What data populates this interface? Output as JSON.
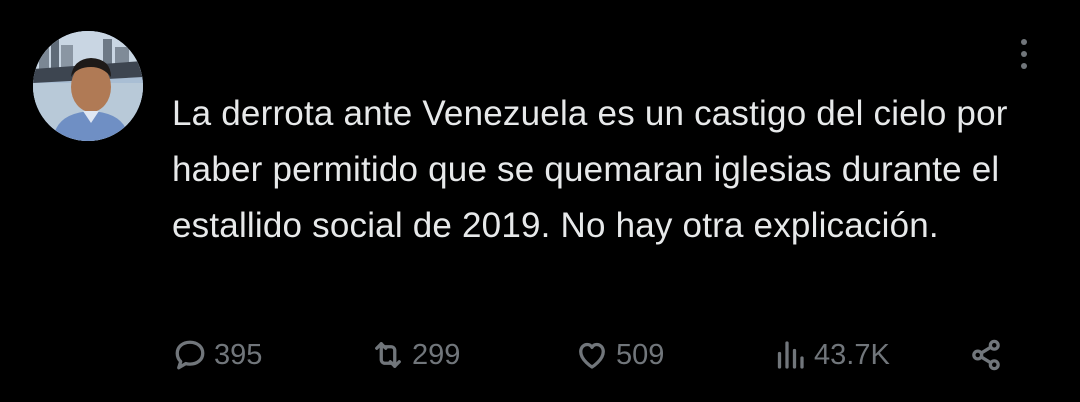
{
  "author": {
    "name": "",
    "handle": "",
    "time": ""
  },
  "tweet": {
    "text": "La derrota ante Venezuela es un castigo del cielo por haber permitido que se quemaran iglesias durante el estallido social de 2019. No hay otra explicación."
  },
  "stats": {
    "replies": "395",
    "retweets": "299",
    "likes": "509",
    "views": "43.7K"
  },
  "icons": {
    "reply": "speech-bubble-icon",
    "retweet": "retweet-icon",
    "like": "heart-icon",
    "views": "bar-chart-icon",
    "share": "share-nodes-icon",
    "more": "vertical-ellipsis-icon"
  },
  "colors": {
    "background": "#000000",
    "text": "#e7e9ea",
    "muted": "#71767b"
  }
}
